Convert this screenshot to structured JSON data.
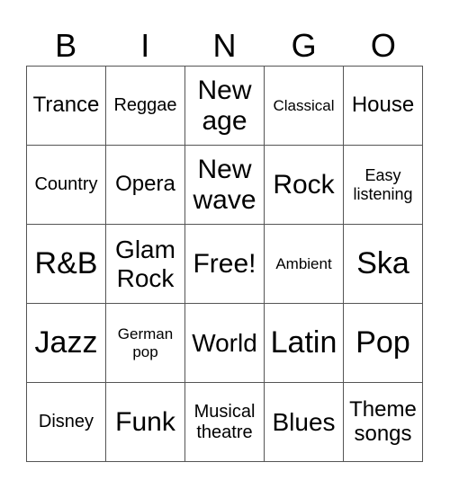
{
  "header": {
    "letters": [
      "B",
      "I",
      "N",
      "G",
      "O"
    ]
  },
  "board": {
    "rows": [
      [
        "Trance",
        "Reggae",
        "New age",
        "Classical",
        "House"
      ],
      [
        "Country",
        "Opera",
        "New wave",
        "Rock",
        "Easy listening"
      ],
      [
        "R&B",
        "Glam Rock",
        "Free!",
        "Ambient",
        "Ska"
      ],
      [
        "Jazz",
        "German pop",
        "World",
        "Latin",
        "Pop"
      ],
      [
        "Disney",
        "Funk",
        "Musical theatre",
        "Blues",
        "Theme songs"
      ]
    ],
    "free_space": "Free!"
  },
  "colors": {
    "background": "#ffffff",
    "text": "#000000",
    "grid_line": "#555555"
  }
}
